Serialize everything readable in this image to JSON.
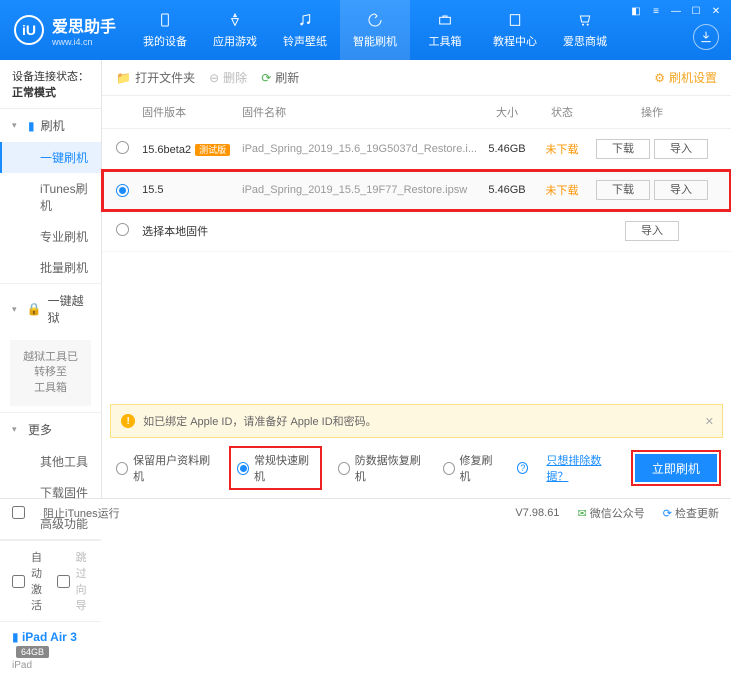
{
  "app": {
    "name": "爱思助手",
    "url": "www.i4.cn"
  },
  "nav": [
    {
      "label": "我的设备"
    },
    {
      "label": "应用游戏"
    },
    {
      "label": "铃声壁纸"
    },
    {
      "label": "智能刷机"
    },
    {
      "label": "工具箱"
    },
    {
      "label": "教程中心"
    },
    {
      "label": "爱思商城"
    }
  ],
  "sidebar": {
    "conn_label": "设备连接状态：",
    "conn_value": "正常模式",
    "flash_head": "刷机",
    "flash_items": [
      "一键刷机",
      "iTunes刷机",
      "专业刷机",
      "批量刷机"
    ],
    "jb_head": "一键越狱",
    "jb_note": "越狱工具已转移至\n工具箱",
    "more_head": "更多",
    "more_items": [
      "其他工具",
      "下载固件",
      "高级功能"
    ],
    "auto_act": "自动激活",
    "skip_guide": "跳过向导",
    "device_name": "iPad Air 3",
    "device_cap": "64GB",
    "device_type": "iPad"
  },
  "toolbar": {
    "open": "打开文件夹",
    "delete": "删除",
    "refresh": "刷新",
    "settings": "刷机设置"
  },
  "cols": {
    "ver": "固件版本",
    "name": "固件名称",
    "size": "大小",
    "status": "状态",
    "ops": "操作"
  },
  "rows": [
    {
      "ver": "15.6beta2",
      "tag": "测试版",
      "name": "iPad_Spring_2019_15.6_19G5037d_Restore.i...",
      "size": "5.46GB",
      "status": "未下载",
      "selected": false
    },
    {
      "ver": "15.5",
      "tag": "",
      "name": "iPad_Spring_2019_15.5_19F77_Restore.ipsw",
      "size": "5.46GB",
      "status": "未下载",
      "selected": true
    }
  ],
  "local_fw": "选择本地固件",
  "ops": {
    "download": "下载",
    "import": "导入"
  },
  "warn": "如已绑定 Apple ID，请准备好 Apple ID和密码。",
  "modes": [
    {
      "label": "保留用户资料刷机",
      "checked": false
    },
    {
      "label": "常规快速刷机",
      "checked": true
    },
    {
      "label": "防数据恢复刷机",
      "checked": false
    },
    {
      "label": "修复刷机",
      "checked": false
    }
  ],
  "exclude_link": "只想排除数据？",
  "flash_btn": "立即刷机",
  "status": {
    "block": "阻止iTunes运行",
    "ver": "V7.98.61",
    "wx": "微信公众号",
    "update": "检查更新"
  }
}
